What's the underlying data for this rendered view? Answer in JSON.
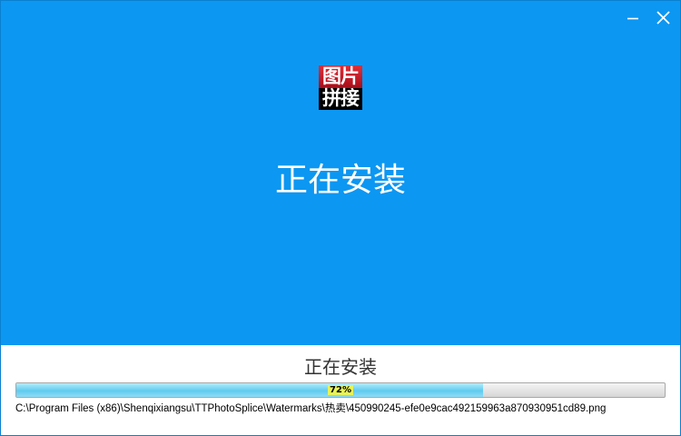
{
  "window": {
    "controls": {
      "minimize_icon": "minimize-icon",
      "close_icon": "close-icon"
    }
  },
  "header": {
    "logo": {
      "line1": "图片",
      "line2": "拼接"
    },
    "heading": "正在安装"
  },
  "progress": {
    "label": "正在安装",
    "percent_text": "72%",
    "value": 0.72,
    "current_file": "C:\\Program Files (x86)\\Shenqixiangsu\\TTPhotoSplice\\Watermarks\\热卖\\450990245-efe0e9cac492159963a870930951cd89.png"
  },
  "colors": {
    "banner_blue": "#0c97f2",
    "progress_fill": "#5fcbef",
    "logo_red": "#c3121f",
    "percent_highlight": "#e7f35a"
  }
}
